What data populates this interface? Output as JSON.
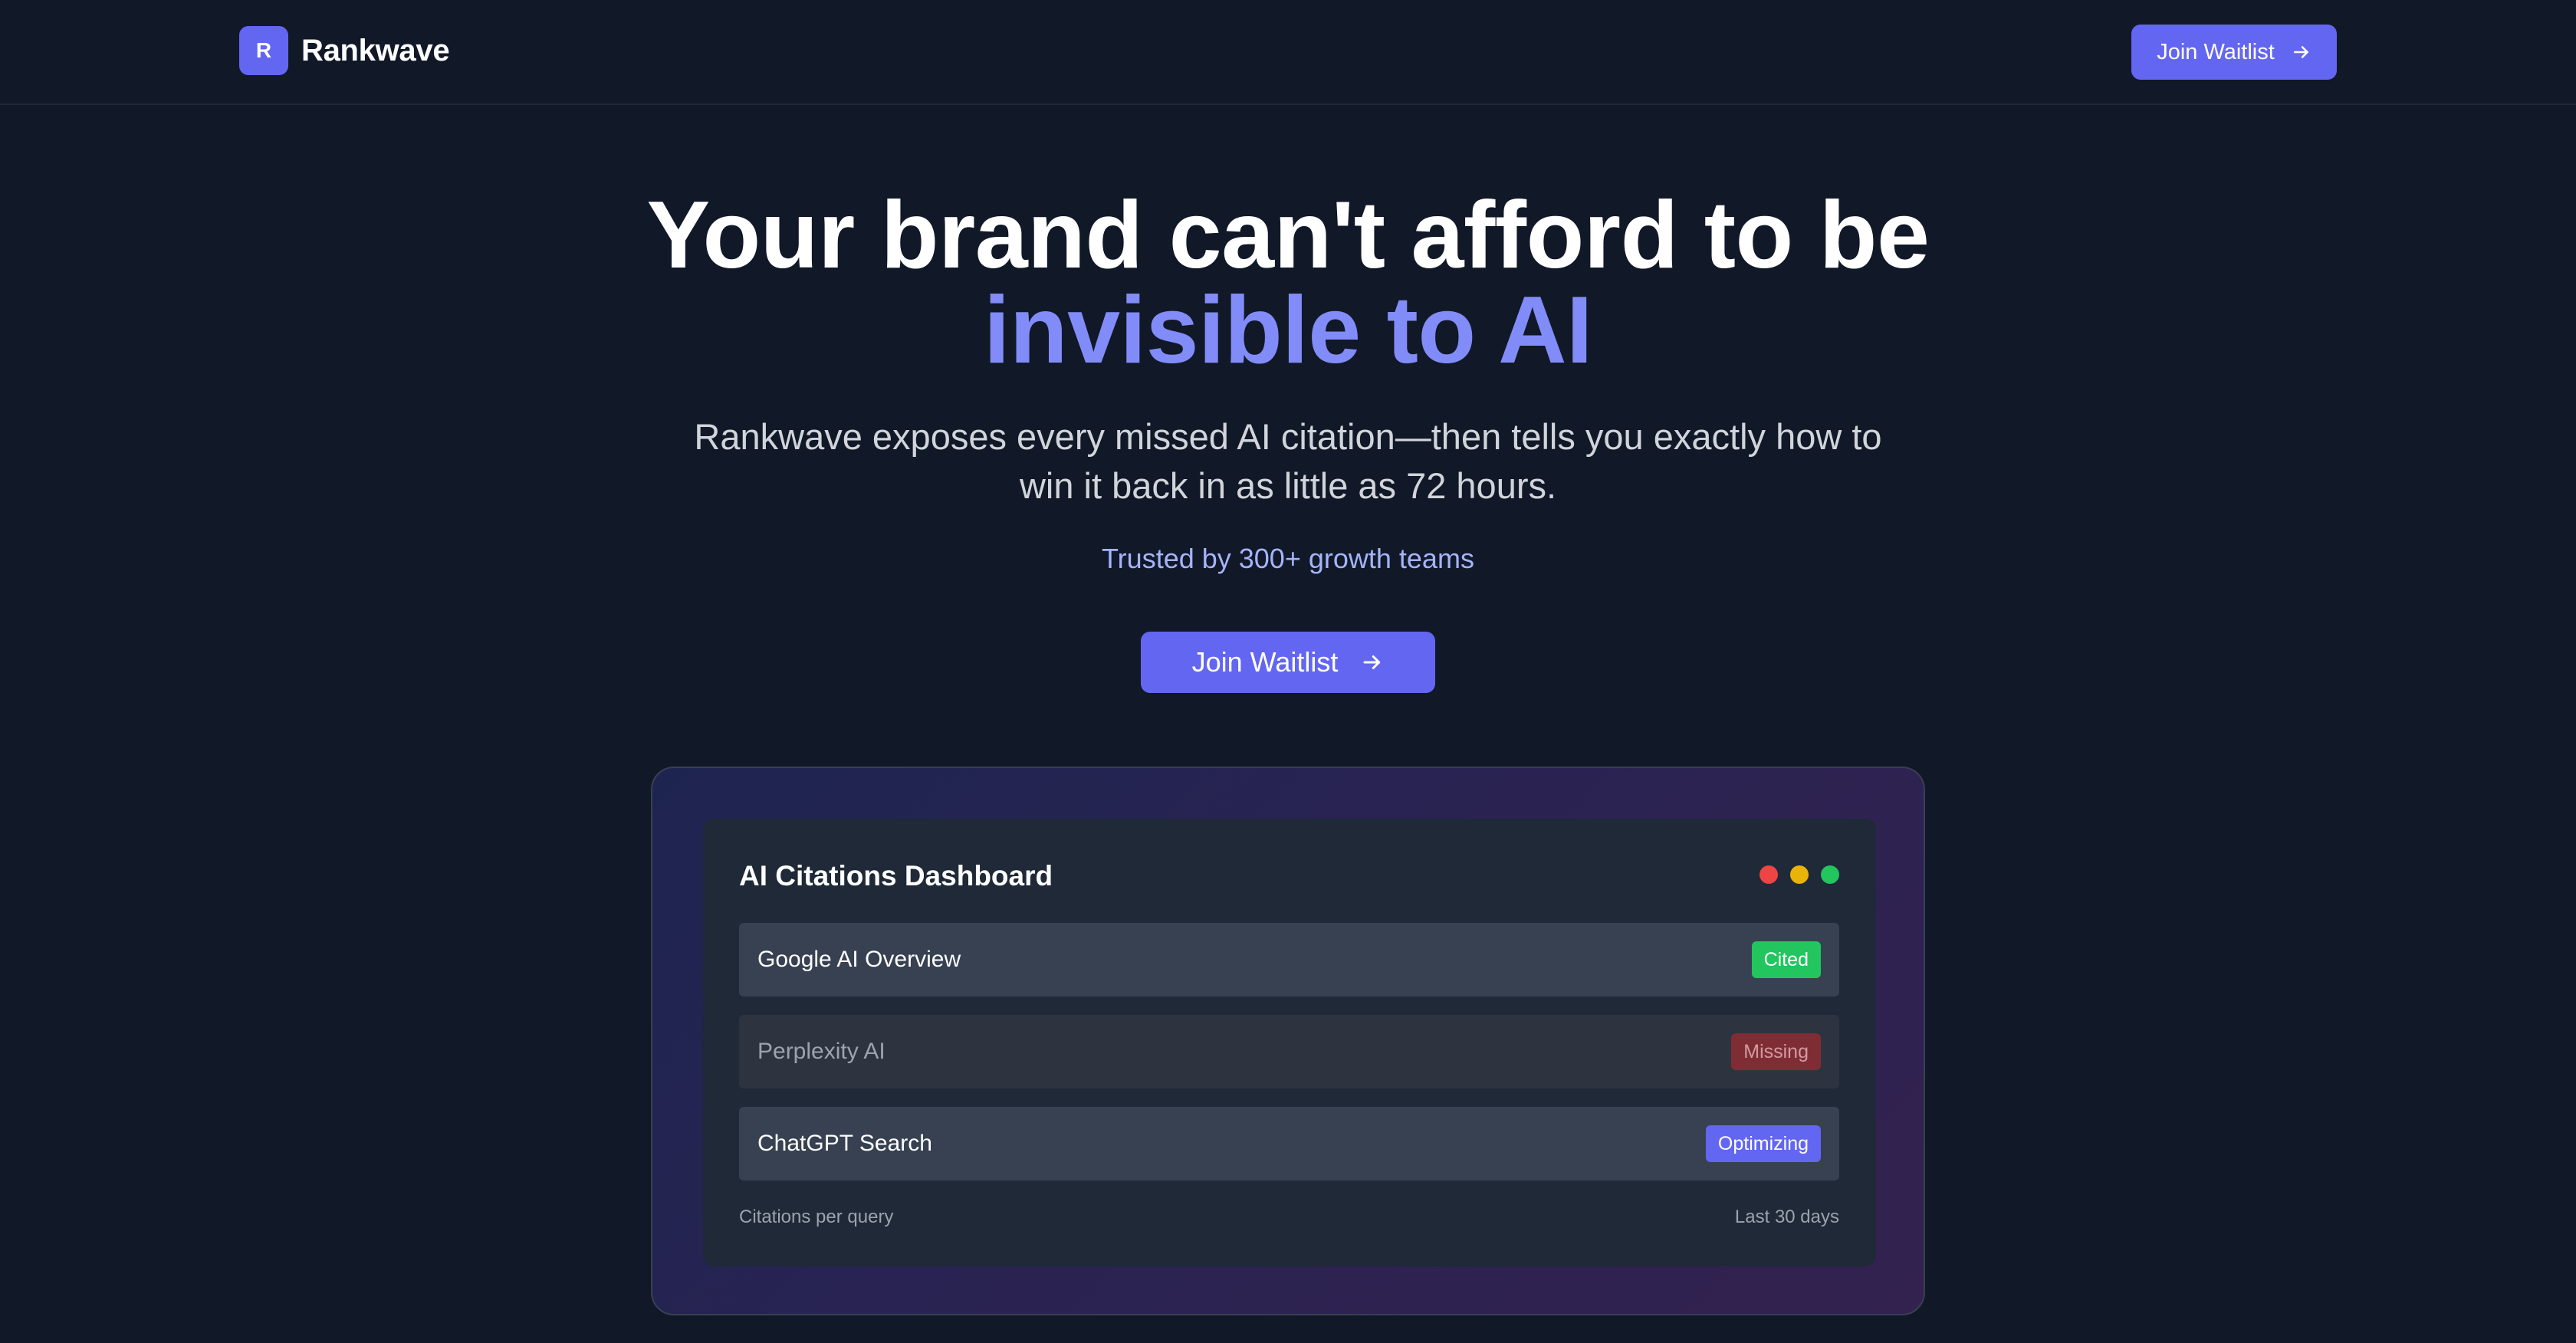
{
  "header": {
    "logo_letter": "R",
    "brand_name": "Rankwave",
    "cta_label": "Join Waitlist"
  },
  "hero": {
    "title_line1": "Your brand can't afford to be",
    "title_line2": "invisible to AI",
    "subtitle": "Rankwave exposes every missed AI citation—then tells you exactly how to win it back in as little as 72 hours.",
    "trusted": "Trusted by 300+ growth teams",
    "cta_label": "Join Waitlist"
  },
  "dashboard": {
    "title": "AI Citations Dashboard",
    "rows": [
      {
        "label": "Google AI Overview",
        "status": "Cited"
      },
      {
        "label": "Perplexity AI",
        "status": "Missing"
      },
      {
        "label": "ChatGPT Search",
        "status": "Optimizing"
      }
    ],
    "footer_left": "Citations per query",
    "footer_right": "Last 30 days"
  },
  "icons": {
    "cta_icon": "arrow-right-icon",
    "window_controls": [
      "red-dot-icon",
      "yellow-dot-icon",
      "green-dot-icon"
    ]
  },
  "colors": {
    "background": "#111827",
    "accent": "#6366f1",
    "accent_light": "#818cf8",
    "cited": "#22c55e",
    "missing": "#7f2d35",
    "optimizing": "#6366f1"
  }
}
